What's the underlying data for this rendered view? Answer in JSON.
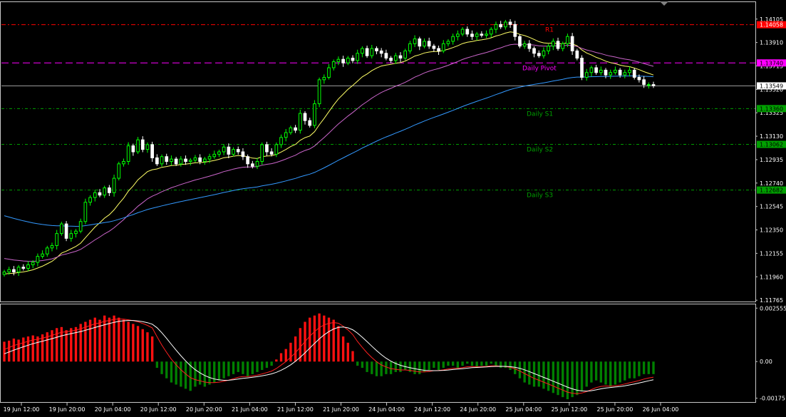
{
  "chart_data": [
    {
      "type": "candlestick",
      "title": "",
      "colors": {
        "bull": "#00ff00",
        "bear": "#ffffff",
        "ema_fast": "#ffff66",
        "ema_mid": "#cc66cc",
        "ema_slow": "#3399ff",
        "resistance": "#ff0000",
        "pivot": "#ff00ff",
        "support": "#00a000",
        "current_price": "#ffffff"
      },
      "ylim": [
        1.1176,
        1.1424
      ],
      "y_ticks": [
        "1.14105",
        "1.13910",
        "1.13715",
        "1.13520",
        "1.13325",
        "1.13130",
        "1.12935",
        "1.12740",
        "1.12545",
        "1.12350",
        "1.12155",
        "1.11960",
        "1.11765"
      ],
      "x_ticks": [
        "19 Jun 12:00",
        "19 Jun 20:00",
        "20 Jun 04:00",
        "20 Jun 12:00",
        "20 Jun 20:00",
        "21 Jun 04:00",
        "21 Jun 12:00",
        "21 Jun 20:00",
        "24 Jun 04:00",
        "24 Jun 12:00",
        "24 Jun 20:00",
        "25 Jun 04:00",
        "25 Jun 12:00",
        "25 Jun 20:00",
        "26 Jun 04:00"
      ],
      "levels": [
        {
          "name": "R1",
          "value": 1.14058,
          "tag": "1.14058",
          "kind": "resistance"
        },
        {
          "name": "Daily Pivot",
          "value": 1.1374,
          "tag": "1.13740",
          "kind": "pivot"
        },
        {
          "name": "Daily S1",
          "value": 1.1336,
          "tag": "1.13360",
          "kind": "support"
        },
        {
          "name": "Daily S2",
          "value": 1.13062,
          "tag": "1.13062",
          "kind": "support"
        },
        {
          "name": "Daily S3",
          "value": 1.12682,
          "tag": "1.12682",
          "kind": "support"
        }
      ],
      "current_price": {
        "value": 1.13549,
        "tag": "1.13549"
      },
      "close": [
        1.12,
        1.1202,
        1.12,
        1.1204,
        1.1203,
        1.1206,
        1.1208,
        1.1213,
        1.1215,
        1.122,
        1.1222,
        1.1232,
        1.124,
        1.1228,
        1.1232,
        1.1234,
        1.1242,
        1.1258,
        1.1262,
        1.1266,
        1.1264,
        1.127,
        1.1266,
        1.1278,
        1.129,
        1.1292,
        1.1305,
        1.13,
        1.131,
        1.1302,
        1.1306,
        1.1295,
        1.129,
        1.1296,
        1.1292,
        1.1294,
        1.129,
        1.1294,
        1.1292,
        1.1293,
        1.1295,
        1.1292,
        1.1294,
        1.1296,
        1.1298,
        1.13,
        1.1304,
        1.1298,
        1.1302,
        1.13,
        1.1296,
        1.129,
        1.1288,
        1.1292,
        1.1306,
        1.13,
        1.1298,
        1.1306,
        1.1312,
        1.1316,
        1.132,
        1.1318,
        1.1332,
        1.1326,
        1.1322,
        1.134,
        1.136,
        1.1362,
        1.137,
        1.1375,
        1.1377,
        1.1374,
        1.1378,
        1.1376,
        1.1382,
        1.1386,
        1.138,
        1.1386,
        1.1384,
        1.1382,
        1.1378,
        1.1376,
        1.138,
        1.1378,
        1.1384,
        1.139,
        1.1394,
        1.1388,
        1.1392,
        1.1388,
        1.1386,
        1.1384,
        1.139,
        1.1392,
        1.1396,
        1.1398,
        1.1402,
        1.1398,
        1.1396,
        1.1398,
        1.1397,
        1.1398,
        1.1402,
        1.1406,
        1.1404,
        1.1408,
        1.1406,
        1.1396,
        1.1388,
        1.139,
        1.1386,
        1.1382,
        1.138,
        1.1384,
        1.1388,
        1.1392,
        1.1386,
        1.139,
        1.1396,
        1.1384,
        1.1378,
        1.1362,
        1.1366,
        1.137,
        1.1366,
        1.1368,
        1.1364,
        1.1366,
        1.1368,
        1.1364,
        1.1366,
        1.1368,
        1.1362,
        1.136,
        1.1356,
        1.1356,
        1.1355
      ],
      "indicator_panel": {
        "y_ticks": [
          "0.002555",
          "0.00",
          "-0.00175"
        ],
        "ylim": [
          -0.0019,
          0.0027
        ],
        "histogram": [
          0.00095,
          0.001,
          0.0011,
          0.00105,
          0.00115,
          0.0012,
          0.00125,
          0.0012,
          0.0013,
          0.0014,
          0.0015,
          0.0016,
          0.00165,
          0.0015,
          0.0016,
          0.00165,
          0.0018,
          0.0019,
          0.002,
          0.0021,
          0.002,
          0.0022,
          0.0021,
          0.0022,
          0.0021,
          0.002,
          0.0019,
          0.0018,
          0.0017,
          0.00155,
          0.0014,
          0.0012,
          -0.0003,
          -0.0006,
          -0.0008,
          -0.001,
          -0.0011,
          -0.0012,
          -0.0013,
          -0.0014,
          -0.0012,
          -0.0011,
          -0.0012,
          -0.0011,
          -0.001,
          -0.0009,
          -0.0008,
          -0.0007,
          -0.0006,
          -0.0005,
          -0.0006,
          -0.0007,
          -0.0006,
          -0.0005,
          -0.0004,
          -0.0003,
          -0.0002,
          0.0001,
          0.0004,
          0.0006,
          0.0009,
          0.0012,
          0.0016,
          0.0019,
          0.0021,
          0.0022,
          0.0023,
          0.0022,
          0.0021,
          0.002,
          0.0017,
          0.0012,
          0.0009,
          0.0005,
          -0.0002,
          -0.0003,
          -0.0005,
          -0.0006,
          -0.0007,
          -0.0007,
          -0.0006,
          -0.0006,
          -0.0005,
          -0.0005,
          -0.0004,
          -0.0005,
          -0.0006,
          -0.0006,
          -0.0005,
          -0.0004,
          -0.0003,
          -0.0004,
          -0.0003,
          -0.0002,
          -0.0002,
          -0.0003,
          -0.0002,
          -0.0001,
          -0.0002,
          -0.0003,
          -0.0002,
          -0.0002,
          -0.0001,
          -0.0002,
          -0.0003,
          -0.0003,
          -0.0004,
          -0.0006,
          -0.0008,
          -0.001,
          -0.0011,
          -0.0012,
          -0.0012,
          -0.0013,
          -0.0014,
          -0.0015,
          -0.0016,
          -0.0017,
          -0.0018,
          -0.0017,
          -0.0016,
          -0.0014,
          -0.0012,
          -0.001,
          -0.0009,
          -0.001,
          -0.0011,
          -0.0012,
          -0.0011,
          -0.001,
          -0.0009,
          -0.0008,
          -0.0008,
          -0.0007,
          -0.0006,
          -0.0006,
          -0.0006
        ]
      }
    }
  ]
}
